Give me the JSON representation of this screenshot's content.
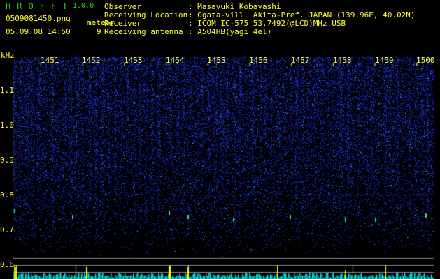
{
  "header": {
    "app_title": "HROFFT",
    "version": "1.0.0",
    "filename": "0509081450.png",
    "datetime": "05.09.08 14:50",
    "meteor_label": "meteor",
    "meteor_count": "9"
  },
  "info": [
    {
      "key": "Observer",
      "value": ": Masayuki Kobayashi"
    },
    {
      "key": "Receiving Location",
      "value": ": Ogata-vill. Akita-Pref. JAPAN (139.96E, 40.02N)"
    },
    {
      "key": "Receiver",
      "value": ": ICOM IC-575 53.7492(@LCD)MHz USB"
    },
    {
      "key": "Receiving antenna",
      "value": ": A504HB(yagi 4el)"
    }
  ],
  "spectrogram": {
    "y_unit": "kHz",
    "y_ticks": [
      "1.1",
      "1.0",
      "0.9",
      "0.8",
      "0.7",
      "0.6"
    ],
    "x_ticks": [
      "1451",
      "1452",
      "1453",
      "1454",
      "1455",
      "1456",
      "1457",
      "1458",
      "1459",
      "1500"
    ],
    "colors": {
      "background": "#000000",
      "noise": "#2030e0",
      "histogram": "#00e8f0",
      "meteor_marker": "#ffff00",
      "label": "#ffff30",
      "title": "#20d020"
    }
  }
}
